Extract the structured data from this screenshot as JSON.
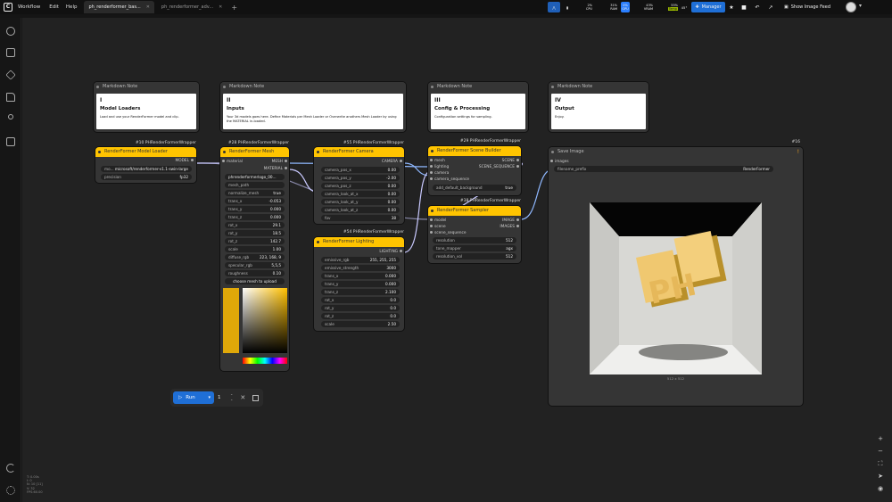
{
  "topbar": {
    "logo": "C",
    "menu": [
      "Workflow",
      "Edit",
      "Help"
    ],
    "tabs": [
      {
        "label": "ph_renderformer_bas...",
        "active": true
      },
      {
        "label": "ph_renderformer_adv...",
        "active": false
      }
    ],
    "add_tab": "+",
    "cpu": {
      "label": "CPU",
      "value": "2%",
      "level": 0.02
    },
    "ram": {
      "label": "RAM",
      "value": "31%",
      "level": 0.31
    },
    "gpu": {
      "label": "GPU",
      "value": "0%",
      "level": 0.0
    },
    "vram": {
      "label": "VRAM",
      "value": "43%",
      "level": 0.43
    },
    "temp": {
      "label": "Temp",
      "value": "55%",
      "level": 0.55
    },
    "temp_c": "45°",
    "manager": "Manager",
    "show_image_feed": "Show Image Feed"
  },
  "sidebar_icons": [
    "history-icon",
    "queue-icon",
    "models-icon",
    "workflows-icon",
    "nodes-icon",
    "templates-icon",
    "theme-icon",
    "settings-icon"
  ],
  "notes": [
    {
      "header": "Markdown Note",
      "roman": "I",
      "title": "Model Loaders",
      "desc": "Load and use your RenderFormer model and clip."
    },
    {
      "header": "Markdown Note",
      "roman": "II",
      "title": "Inputs",
      "desc": "Your 3d models goes here. Define Materials per Mesh Loader or Overwrite anothers Mesh Loader by using the MATERIAL in-loaded."
    },
    {
      "header": "Markdown Note",
      "roman": "III",
      "title": "Config & Processing",
      "desc": "Configuration settings for sampling."
    },
    {
      "header": "Markdown Note",
      "roman": "IV",
      "title": "Output",
      "desc": "Enjoy."
    }
  ],
  "node10": {
    "id": "#10 PHRenderFormerWrapper",
    "title": "RenderFormer Model Loader",
    "out": "MODEL",
    "model_label": "mo...",
    "model_value": "microsoft/renderformer-v1.1-swin-large",
    "precision_label": "precision",
    "precision_value": "fp32"
  },
  "node28": {
    "id": "#28 PHRenderFormerWrapper",
    "title": "RenderFormer Mesh Loader",
    "in_material": "material",
    "out_mesh": "MESH",
    "out_material": "MATERIAL",
    "mesh_value": "phrenderformerlogo_00...",
    "mesh_path": "mesh_path",
    "normalize_label": "normalize_mesh",
    "normalize_value": "true",
    "fields": [
      {
        "l": "trans_x",
        "v": "-0.053"
      },
      {
        "l": "trans_y",
        "v": "0.000"
      },
      {
        "l": "trans_z",
        "v": "0.000"
      },
      {
        "l": "rot_x",
        "v": "29.1"
      },
      {
        "l": "rot_y",
        "v": "18.5"
      },
      {
        "l": "rot_z",
        "v": "142.7"
      },
      {
        "l": "scale",
        "v": "1.00"
      }
    ],
    "diffuse_label": "diffuse_rgb",
    "diffuse_value": "223, 168, 9",
    "specular_label": "specular_rgb",
    "specular_value": "5,5,5",
    "rough_label": "roughness",
    "rough_value": "0.10",
    "upload": "choose mesh to upload",
    "swatch": "#dfa809"
  },
  "node55": {
    "id": "#55 PHRenderFormerWrapper",
    "title": "RenderFormer Camera",
    "out": "CAMERA",
    "fields": [
      {
        "l": "camera_pos_x",
        "v": "0.00"
      },
      {
        "l": "camera_pos_y",
        "v": "-2.00"
      },
      {
        "l": "camera_pos_z",
        "v": "0.00"
      },
      {
        "l": "camera_look_at_x",
        "v": "0.00"
      },
      {
        "l": "camera_look_at_y",
        "v": "0.00"
      },
      {
        "l": "camera_look_at_z",
        "v": "0.00"
      },
      {
        "l": "fov",
        "v": "38"
      }
    ]
  },
  "node54": {
    "id": "#54 PHRenderFormerWrapper",
    "title": "RenderFormer Lighting",
    "out": "LIGHTING",
    "fields": [
      {
        "l": "emissive_rgb",
        "v": "255, 255, 255"
      },
      {
        "l": "emissive_strength",
        "v": "3000"
      },
      {
        "l": "trans_x",
        "v": "0.000"
      },
      {
        "l": "trans_y",
        "v": "0.000"
      },
      {
        "l": "trans_z",
        "v": "2.100"
      },
      {
        "l": "rot_x",
        "v": "0.0"
      },
      {
        "l": "rot_y",
        "v": "0.0"
      },
      {
        "l": "rot_z",
        "v": "0.0"
      },
      {
        "l": "scale",
        "v": "2.50"
      }
    ]
  },
  "node29": {
    "id": "#29 PHRenderFormerWrapper",
    "title": "RenderFormer Scene Builder",
    "inputs": [
      "mesh",
      "lighting",
      "camera",
      "camera_sequence"
    ],
    "out_scene": "SCENE",
    "out_seq": "SCENE_SEQUENCE",
    "bg_label": "add_default_background",
    "bg_value": "true"
  },
  "node38": {
    "id": "#38 PHRenderFormerWrapper",
    "title": "RenderFormer Sampler",
    "inputs": [
      "model",
      "scene",
      "scene_sequence"
    ],
    "out_image": "IMAGE",
    "out_images": "IMAGES",
    "fields": [
      {
        "l": "resolution",
        "v": "512"
      },
      {
        "l": "tone_mapper",
        "v": "agx"
      },
      {
        "l": "resolution_vol",
        "v": "512"
      }
    ]
  },
  "node16": {
    "id": "#16",
    "title": "Save Image",
    "in_images": "images",
    "prefix_label": "filename_prefix",
    "prefix_value": "RenderFormer",
    "caption": "512 x 512",
    "logo_text": "PH"
  },
  "runbar": {
    "run": "Run",
    "batch": "1"
  },
  "stats": {
    "lines": [
      "T: 0.00s",
      "I: 0",
      "N: 10 [11]",
      "V: 32",
      "FPS:60.00"
    ]
  }
}
